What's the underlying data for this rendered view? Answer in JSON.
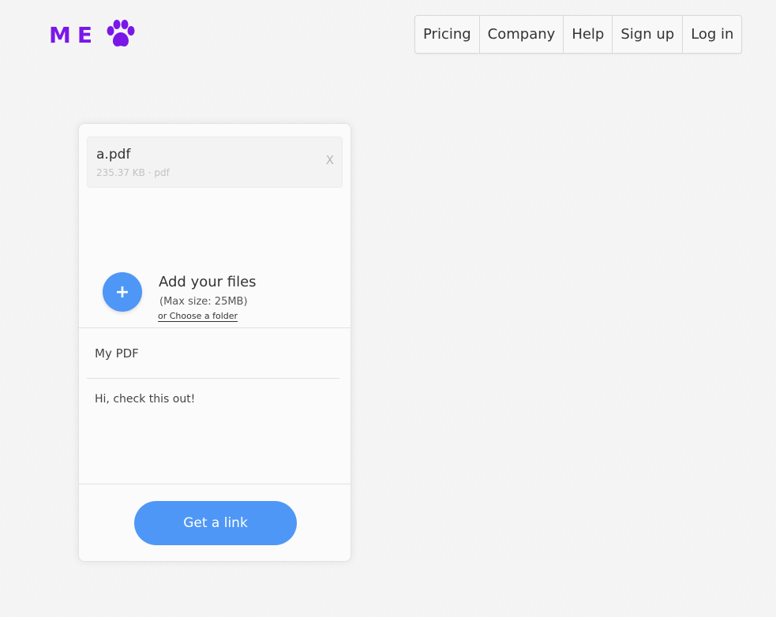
{
  "logo": {
    "text": "ME",
    "icon": "paw-icon",
    "color": "#7a17e8"
  },
  "nav": {
    "items": [
      {
        "label": "Pricing"
      },
      {
        "label": "Company"
      },
      {
        "label": "Help"
      },
      {
        "label": "Sign up"
      },
      {
        "label": "Log in"
      }
    ]
  },
  "upload": {
    "file": {
      "name": "a.pdf",
      "meta": "235.37 KB · pdf",
      "remove_label": "X"
    },
    "add": {
      "icon_label": "+",
      "title": "Add your files",
      "subtitle": "(Max size: 25MB)",
      "folder_link": "or Choose a folder"
    },
    "title_field": {
      "value": "My PDF"
    },
    "message_field": {
      "value": "Hi, check this out!"
    },
    "submit_label": "Get a link"
  },
  "colors": {
    "accent": "#4f97f6",
    "brand": "#7a17e8"
  }
}
